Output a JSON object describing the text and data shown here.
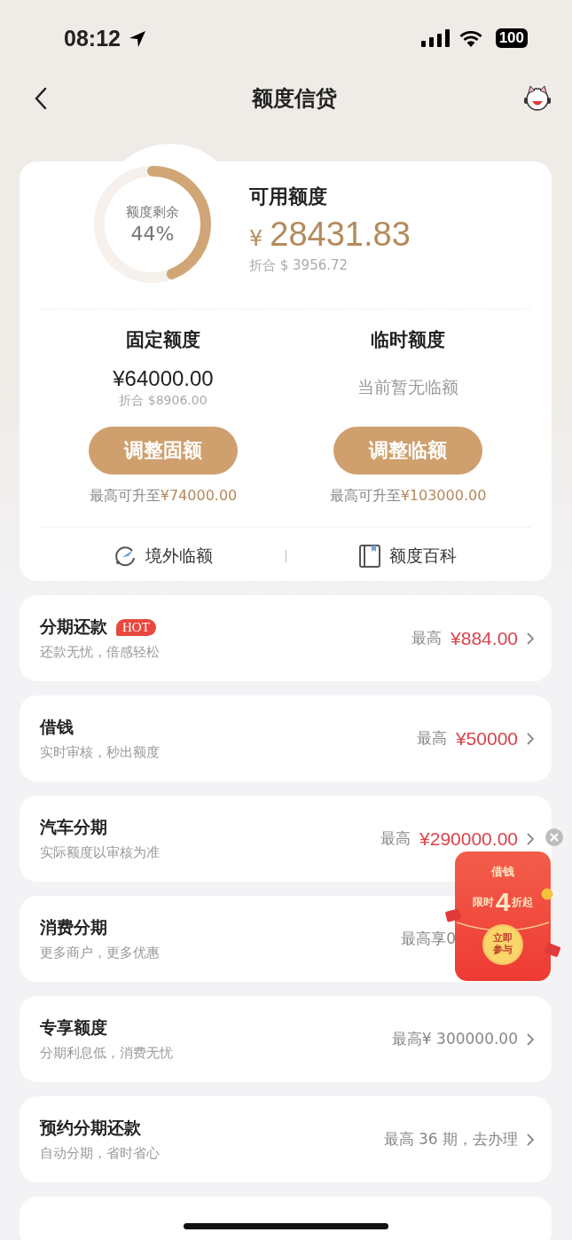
{
  "status_bar": {
    "time": "08:12",
    "battery": "100"
  },
  "nav": {
    "title": "额度信贷"
  },
  "summary": {
    "ring_label": "额度剩余",
    "ring_percent": "44%",
    "level": 0.44,
    "title": "可用额度",
    "currency": "¥",
    "amount": "28431.83",
    "converted": "折合 $ 3956.72"
  },
  "limits": [
    {
      "title": "固定额度",
      "amount": "¥64000.00",
      "converted": "折合 $8906.00",
      "button": "调整固额",
      "max_label": "最高可升至",
      "max_value": "¥74000.00"
    },
    {
      "title": "临时额度",
      "note": "当前暂无临额",
      "button": "调整临额",
      "max_label": "最高可升至",
      "max_value": "¥103000.00"
    }
  ],
  "links": [
    {
      "label": "境外临额"
    },
    {
      "label": "额度百科"
    }
  ],
  "products": [
    {
      "title": "分期还款",
      "badge": "HOT",
      "subtitle": "还款无忧，倍感轻松",
      "kind": "price",
      "prefix": "最高",
      "value": "¥884.00",
      "chevron": true
    },
    {
      "title": "借钱",
      "subtitle": "实时审核，秒出额度",
      "kind": "price",
      "prefix": "最高",
      "value": "¥50000",
      "chevron": true
    },
    {
      "title": "汽车分期",
      "subtitle": "实际额度以审核为准",
      "kind": "price",
      "prefix": "最高",
      "value": "¥290000.00",
      "chevron": true
    },
    {
      "title": "消费分期",
      "subtitle": "更多商户，更多优惠",
      "kind": "text",
      "value": "最高享0",
      "chevron": false
    },
    {
      "title": "专享额度",
      "subtitle": "分期利息低，消费无忧",
      "kind": "text",
      "value": "最高¥ 300000.00",
      "chevron": true
    },
    {
      "title": "预约分期还款",
      "subtitle": "自动分期，省时省心",
      "kind": "text",
      "value": "最高 36 期，去办理",
      "chevron": true
    }
  ],
  "promo": {
    "title": "借钱",
    "line_before": "限时",
    "big": "4",
    "line_after": "折起",
    "button": "立即参与"
  }
}
